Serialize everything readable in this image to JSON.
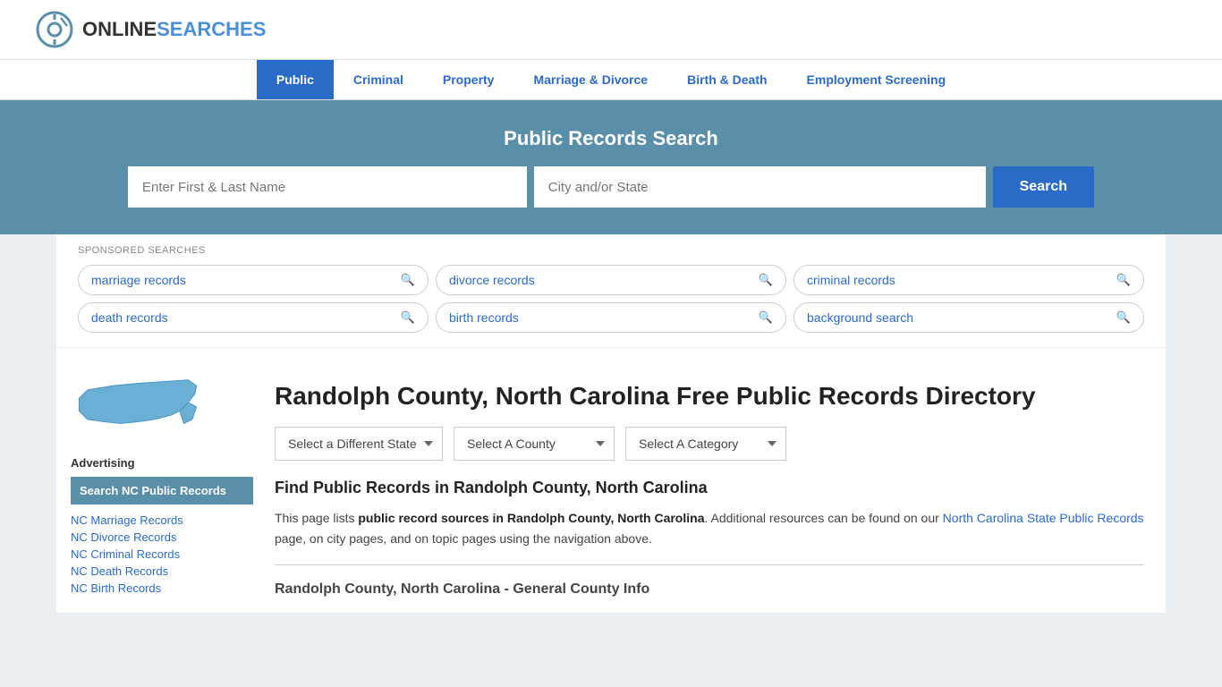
{
  "header": {
    "logo_online": "ONLINE",
    "logo_searches": "SEARCHES"
  },
  "nav": {
    "items": [
      {
        "label": "Public",
        "active": true
      },
      {
        "label": "Criminal",
        "active": false
      },
      {
        "label": "Property",
        "active": false
      },
      {
        "label": "Marriage & Divorce",
        "active": false
      },
      {
        "label": "Birth & Death",
        "active": false
      },
      {
        "label": "Employment Screening",
        "active": false
      }
    ]
  },
  "banner": {
    "title": "Public Records Search",
    "name_placeholder": "Enter First & Last Name",
    "location_placeholder": "City and/or State",
    "search_button": "Search"
  },
  "sponsored": {
    "label": "SPONSORED SEARCHES",
    "pills": [
      {
        "label": "marriage records"
      },
      {
        "label": "divorce records"
      },
      {
        "label": "criminal records"
      },
      {
        "label": "death records"
      },
      {
        "label": "birth records"
      },
      {
        "label": "background search"
      }
    ]
  },
  "page": {
    "title": "Randolph County, North Carolina Free Public Records Directory",
    "dropdowns": {
      "state_label": "Select a Different State",
      "county_label": "Select A County",
      "category_label": "Select A Category"
    },
    "find_heading": "Find Public Records in Randolph County, North Carolina",
    "find_text_1": "This page lists ",
    "find_text_bold": "public record sources in Randolph County, North Carolina",
    "find_text_2": ". Additional resources can be found on our ",
    "find_link_text": "North Carolina State Public Records",
    "find_text_3": " page, on city pages, and on topic pages using the navigation above.",
    "general_info_heading": "Randolph County, North Carolina - General County Info"
  },
  "sidebar": {
    "advertising_label": "Advertising",
    "ad_box_text": "Search NC Public Records",
    "links": [
      {
        "label": "NC Marriage Records"
      },
      {
        "label": "NC Divorce Records"
      },
      {
        "label": "NC Criminal Records"
      },
      {
        "label": "NC Death Records"
      },
      {
        "label": "NC Birth Records"
      }
    ]
  }
}
